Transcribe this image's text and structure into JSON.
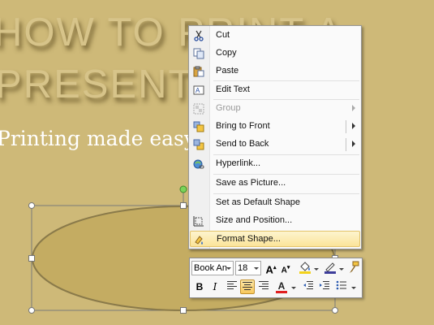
{
  "slide": {
    "title_line1": "HOW TO PRINT A",
    "title_line2": "PRESENTATION",
    "subtitle": "Printing made easy"
  },
  "context_menu": {
    "items": [
      {
        "label": "Cut",
        "icon": "scissors-icon",
        "enabled": true
      },
      {
        "label": "Copy",
        "icon": "copy-icon",
        "enabled": true
      },
      {
        "label": "Paste",
        "icon": "paste-icon",
        "enabled": true
      },
      {
        "label": "Edit Text",
        "icon": "edit-text-icon",
        "enabled": true
      },
      {
        "label": "Group",
        "icon": "group-icon",
        "enabled": false,
        "submenu": true
      },
      {
        "label": "Bring to Front",
        "icon": "bring-to-front-icon",
        "enabled": true,
        "submenu": true
      },
      {
        "label": "Send to Back",
        "icon": "send-to-back-icon",
        "enabled": true,
        "submenu": true
      },
      {
        "label": "Hyperlink...",
        "icon": "hyperlink-icon",
        "enabled": true
      },
      {
        "label": "Save as Picture...",
        "enabled": true
      },
      {
        "label": "Set as Default Shape",
        "enabled": true
      },
      {
        "label": "Size and Position...",
        "icon": "size-position-icon",
        "enabled": true
      },
      {
        "label": "Format Shape...",
        "icon": "format-shape-icon",
        "enabled": true,
        "highlighted": true
      }
    ]
  },
  "mini_toolbar": {
    "font_name": "Book An",
    "font_size": "18",
    "grow_font": "A",
    "shrink_font": "A",
    "bold": "B",
    "italic": "I",
    "font_color_letter": "A"
  },
  "colors": {
    "slide_background": "#ceb978",
    "title_text": "#d7c48a",
    "ellipse_fill": "#c4ac62",
    "ellipse_stroke": "#8a7a4a",
    "menu_highlight": "#fbe49a",
    "font_color_bar": "#e02020",
    "fill_color_bar": "#f3d21b"
  }
}
